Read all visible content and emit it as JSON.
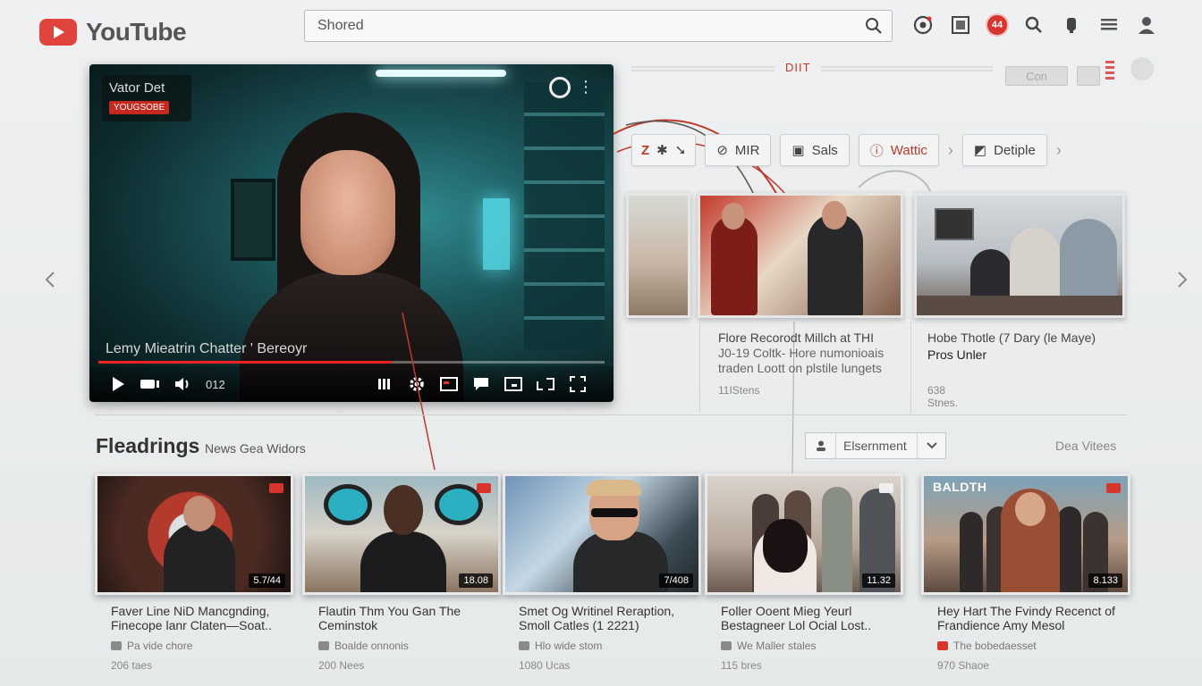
{
  "header": {
    "logo_text": "YouTube",
    "search_value": "Shored",
    "notification_count": "44"
  },
  "player": {
    "channel_name": "Vator Det",
    "channel_badge": "YOUGSOBE",
    "caption": "Lemy Mieatrin Chatter ' Bereoyr",
    "time": "012",
    "progress_percent": 58
  },
  "right_panel": {
    "top_label": "DIIT",
    "top_button": "Con",
    "chips": [
      {
        "label": "MIR"
      },
      {
        "label": "Sals"
      },
      {
        "label": "Wattic"
      },
      {
        "label": "Detiple"
      }
    ],
    "cards": [
      {
        "title_line1": "Flore Recorodt Millch at THI",
        "title_line2": "J0-19 Coltk- Hore numonioais",
        "title_line3": "traden Loott on plstile lungets",
        "meta": "11IStens"
      },
      {
        "title_line1": "Hobe Thotle (7 Dary (le Maye)",
        "title_line2": "Pros Unler",
        "meta": "638 Stnes."
      }
    ]
  },
  "section": {
    "title": "Fleadrings",
    "subtitle": "News Gea Widors",
    "filter_label": "Elsernment",
    "link": "Dea Vitees"
  },
  "videos": [
    {
      "title": "Faver Line NiD Mancgnding, Finecope lanr Claten—Soat..",
      "channel": "Pa vide chore",
      "views": "206 taes",
      "duration": "5.7/44"
    },
    {
      "title": "Flautin Thm You Gan The Ceminstok",
      "channel": "Boalde onnonis",
      "views": "200 Nees",
      "duration": "18.08"
    },
    {
      "title": "Smet Og Writinel Reraption, Smoll Catles (1 2221)",
      "channel": "Hlo wide stom",
      "views": "1080 Ucas",
      "duration": "7/408"
    },
    {
      "title": "Foller Ooent Mieg Yeurl Bestagneer Lol Ocial Lost..",
      "channel": "We Maller stales",
      "views": "115 bres",
      "duration": "11.32"
    },
    {
      "title": "Hey Hart The Fvindy Recenct of Frandience Amy Mesol",
      "channel": "The bobedaesset",
      "views": "970 Shaoe",
      "duration": "8.133",
      "thumb_label": "BALDTH"
    }
  ],
  "colors": {
    "brand_red": "#e0443c",
    "accent_red": "#d9342b",
    "player_teal": "#1b5559"
  }
}
